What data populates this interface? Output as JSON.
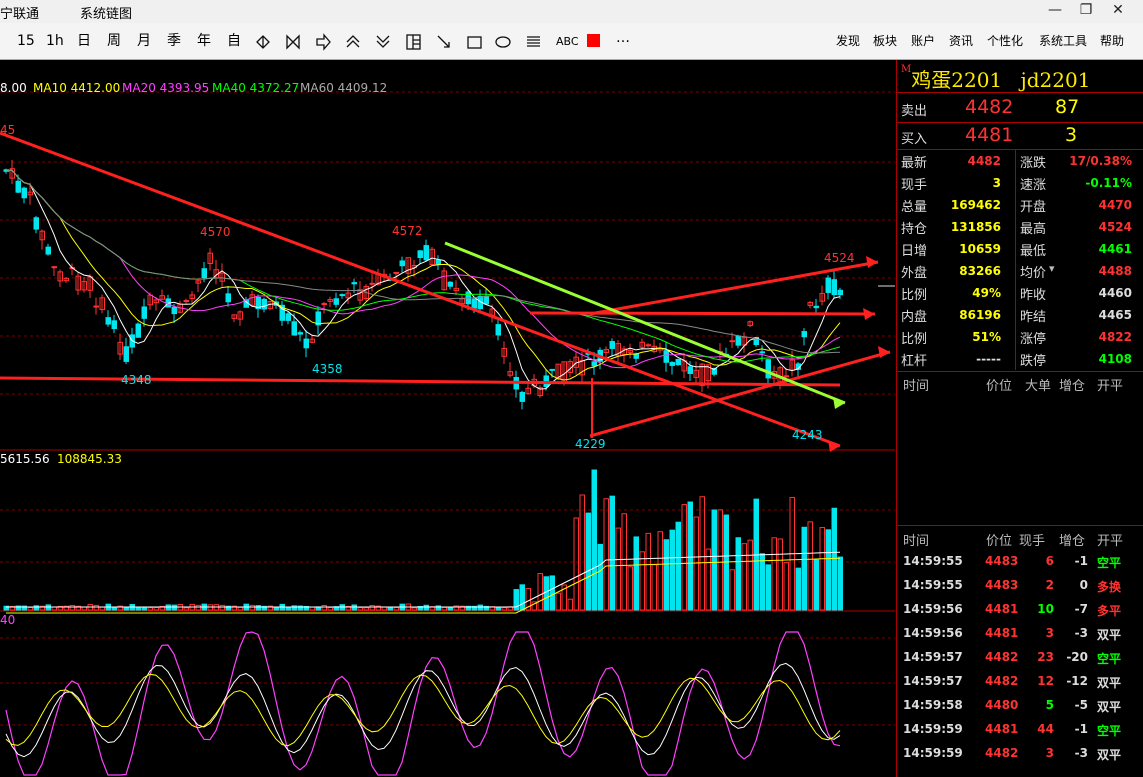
{
  "window": {
    "title_left": "宁联通",
    "menu_title": "系统链图",
    "controls": [
      "—",
      "❐",
      "✕"
    ]
  },
  "toolbar": {
    "buttons": [
      "15",
      "1h",
      "日",
      "周",
      "月",
      "季",
      "年",
      "自"
    ],
    "abc_label": "ABC",
    "more": "…",
    "menus": [
      "发现",
      "板块",
      "账户",
      "资讯",
      "个性化",
      "系统工具",
      "帮助"
    ]
  },
  "chart": {
    "ma_header": {
      "ma5": "8.00",
      "ma10": "MA10 4412.00",
      "ma20": "MA20 4393.95",
      "ma40": "MA40 4372.27",
      "ma60": "MA60 4409.12"
    },
    "price_labels": [
      "45",
      "4570",
      "4572",
      "4524",
      "4348",
      "4358",
      "4229",
      "4243"
    ],
    "volume_header": {
      "v1": "5615.56",
      "v2": "108845.33"
    },
    "indicator_header": "40",
    "colors": {
      "up": "#ff3232",
      "down": "#00e5ee",
      "ma5": "#ffffff",
      "ma10": "#ffff00",
      "ma20": "#ff40ff",
      "ma40": "#00ff00",
      "ma60": "#888888"
    }
  },
  "quote": {
    "name": "鸡蛋2201",
    "code": "jd2201",
    "m_badge": "M",
    "ask_label": "卖出",
    "ask_price": "4482",
    "ask_vol": "87",
    "bid_label": "买入",
    "bid_price": "4481",
    "bid_vol": "3",
    "fields": [
      {
        "l1": "最新",
        "v1": "4482",
        "c1": "#ff3232",
        "l2": "涨跌",
        "v2": "17/0.38%",
        "c2": "#ff3232"
      },
      {
        "l1": "现手",
        "v1": "3",
        "c1": "#ffff00",
        "l2": "速涨",
        "v2": "-0.11%",
        "c2": "#00ff00"
      },
      {
        "l1": "总量",
        "v1": "169462",
        "c1": "#ffff00",
        "l2": "开盘",
        "v2": "4470",
        "c2": "#ff3232"
      },
      {
        "l1": "持仓",
        "v1": "131856",
        "c1": "#ffff00",
        "l2": "最高",
        "v2": "4524",
        "c2": "#ff3232"
      },
      {
        "l1": "日增",
        "v1": "10659",
        "c1": "#ffff00",
        "l2": "最低",
        "v2": "4461",
        "c2": "#00ff00"
      },
      {
        "l1": "外盘",
        "v1": "83266",
        "c1": "#ffff00",
        "l2": "均价",
        "v2": "4488",
        "c2": "#ff3232"
      },
      {
        "l1": "比例",
        "v1": "49%",
        "c1": "#ffff00",
        "l2": "昨收",
        "v2": "4460",
        "c2": "#dddddd"
      },
      {
        "l1": "内盘",
        "v1": "86196",
        "c1": "#ffff00",
        "l2": "昨结",
        "v2": "4465",
        "c2": "#dddddd"
      },
      {
        "l1": "比例",
        "v1": "51%",
        "c1": "#ffff00",
        "l2": "涨停",
        "v2": "4822",
        "c2": "#ff3232"
      },
      {
        "l1": "杠杆",
        "v1": "-----",
        "c1": "#dddddd",
        "l2": "跌停",
        "v2": "4108",
        "c2": "#00ff00"
      }
    ],
    "table_headers": {
      "time": "时间",
      "price": "价位",
      "big": "大单",
      "add": "增仓",
      "open": "开平"
    },
    "ticks_headers": {
      "time": "时间",
      "price": "价位",
      "hand": "现手",
      "add": "增仓",
      "open": "开平"
    },
    "ticks": [
      {
        "time": "14:59:55",
        "price": "4483",
        "hand": "6",
        "add": "-1",
        "type": "空平",
        "hc": "#ff3232",
        "tc": "#00ff00"
      },
      {
        "time": "14:59:55",
        "price": "4483",
        "hand": "2",
        "add": "0",
        "type": "多换",
        "hc": "#ff3232",
        "tc": "#ff3232"
      },
      {
        "time": "14:59:56",
        "price": "4481",
        "hand": "10",
        "add": "-7",
        "type": "多平",
        "hc": "#00ff00",
        "tc": "#ff3232"
      },
      {
        "time": "14:59:56",
        "price": "4481",
        "hand": "3",
        "add": "-3",
        "type": "双平",
        "hc": "#ff3232",
        "tc": "#dddddd"
      },
      {
        "time": "14:59:57",
        "price": "4482",
        "hand": "23",
        "add": "-20",
        "type": "空平",
        "hc": "#ff3232",
        "tc": "#00ff00"
      },
      {
        "time": "14:59:57",
        "price": "4482",
        "hand": "12",
        "add": "-12",
        "type": "双平",
        "hc": "#ff3232",
        "tc": "#dddddd"
      },
      {
        "time": "14:59:58",
        "price": "4480",
        "hand": "5",
        "add": "-5",
        "type": "双平",
        "hc": "#00ff00",
        "tc": "#dddddd"
      },
      {
        "time": "14:59:59",
        "price": "4481",
        "hand": "44",
        "add": "-1",
        "type": "空平",
        "hc": "#ff3232",
        "tc": "#00ff00"
      },
      {
        "time": "14:59:59",
        "price": "4482",
        "hand": "3",
        "add": "-3",
        "type": "双平",
        "hc": "#ff3232",
        "tc": "#dddddd"
      }
    ]
  }
}
